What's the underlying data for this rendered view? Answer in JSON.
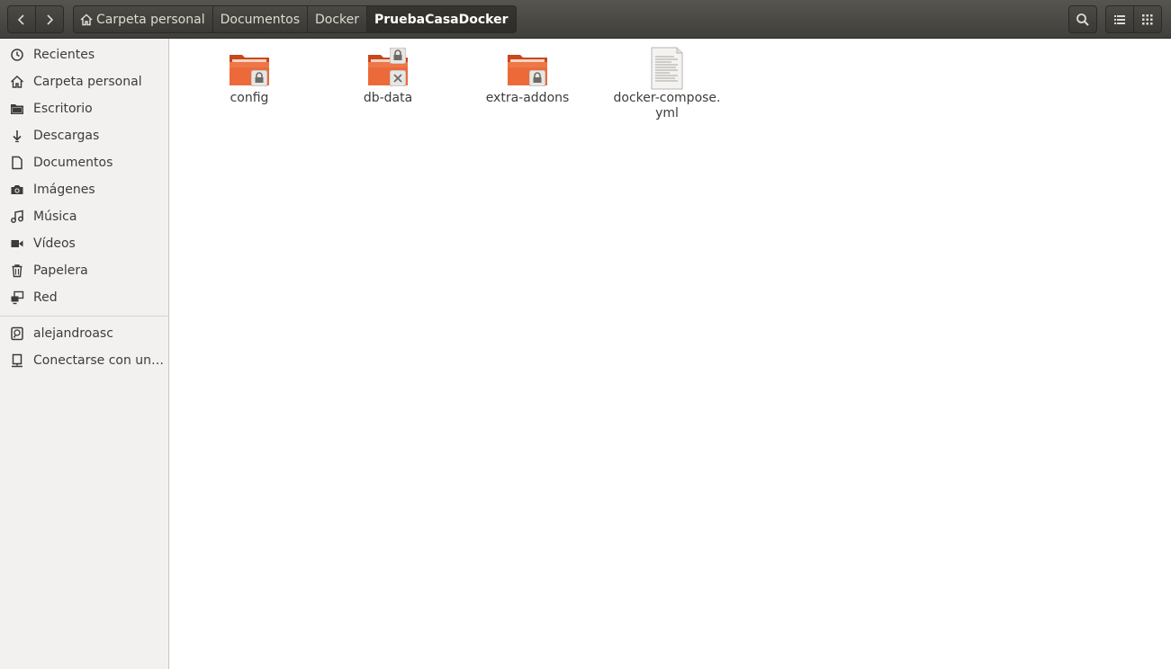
{
  "header": {
    "breadcrumbs": [
      "Carpeta personal",
      "Documentos",
      "Docker",
      "PruebaCasaDocker"
    ],
    "icons": {
      "back": "chevron-left-icon",
      "forward": "chevron-right-icon",
      "home": "home-icon",
      "search": "search-icon",
      "list_view": "list-view-icon",
      "grid_view": "grid-view-icon"
    }
  },
  "sidebar": {
    "places": [
      {
        "label": "Recientes",
        "icon": "clock-icon"
      },
      {
        "label": "Carpeta personal",
        "icon": "home-icon"
      },
      {
        "label": "Escritorio",
        "icon": "folder-icon"
      },
      {
        "label": "Descargas",
        "icon": "download-icon"
      },
      {
        "label": "Documentos",
        "icon": "document-icon"
      },
      {
        "label": "Imágenes",
        "icon": "camera-icon"
      },
      {
        "label": "Música",
        "icon": "music-icon"
      },
      {
        "label": "Vídeos",
        "icon": "video-icon"
      },
      {
        "label": "Papelera",
        "icon": "trash-icon"
      },
      {
        "label": "Red",
        "icon": "network-icon"
      }
    ],
    "other": [
      {
        "label": "alejandroasc",
        "icon": "drive-icon"
      },
      {
        "label": "Conectarse con un servidor",
        "icon": "server-icon"
      }
    ]
  },
  "files": [
    {
      "name": "config",
      "type": "folder",
      "badges": [
        "lock"
      ]
    },
    {
      "name": "db-data",
      "type": "folder",
      "badges": [
        "lock",
        "unreadable"
      ]
    },
    {
      "name": "extra-addons",
      "type": "folder",
      "badges": [
        "lock"
      ]
    },
    {
      "name": "docker-compose.\nyml",
      "type": "text-file",
      "badges": []
    }
  ],
  "colors": {
    "folder": "#e95420",
    "headerbar": "#403f3b",
    "sidebar": "#f2f1f0"
  }
}
